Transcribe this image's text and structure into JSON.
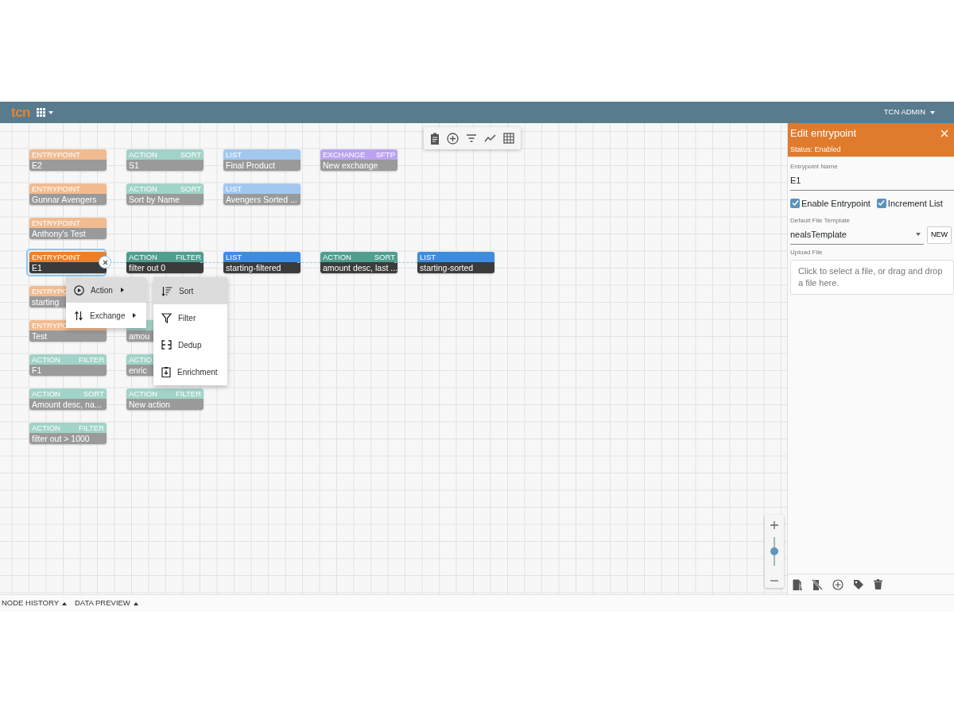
{
  "header": {
    "logo": "tcn",
    "user": "TCN ADMIN"
  },
  "canvas": {
    "rows": [
      [
        {
          "kind": "entrypoint",
          "label": "ENTRYPOINT",
          "name": "E2",
          "active": false,
          "selected": false
        },
        {
          "kind": "action",
          "label": "ACTION",
          "subtype": "SORT",
          "name": "S1",
          "active": false,
          "selected": false
        },
        {
          "kind": "list",
          "label": "LIST",
          "name": "Final Product",
          "active": false,
          "selected": false
        },
        {
          "kind": "exchange",
          "label": "EXCHANGE",
          "subtype": "SFTP",
          "name": "New exchange",
          "active": false,
          "selected": false
        }
      ],
      [
        {
          "kind": "entrypoint",
          "label": "ENTRYPOINT",
          "name": "Gunnar Avengers",
          "active": false,
          "selected": false
        },
        {
          "kind": "action",
          "label": "ACTION",
          "subtype": "SORT",
          "name": "Sort by Name",
          "active": false,
          "selected": false
        },
        {
          "kind": "list",
          "label": "LIST",
          "name": "Avengers Sorted ...",
          "active": false,
          "selected": false
        }
      ],
      [
        {
          "kind": "entrypoint",
          "label": "ENTRYPOINT",
          "name": "Anthony's Test",
          "active": false,
          "selected": false
        }
      ],
      [
        {
          "kind": "entrypoint",
          "label": "ENTRYPOINT",
          "name": "E1",
          "active": true,
          "selected": true
        },
        {
          "kind": "action",
          "label": "ACTION",
          "subtype": "FILTER",
          "name": "filter out 0",
          "active": true,
          "selected": false
        },
        {
          "kind": "list",
          "label": "LIST",
          "name": "starting-filtered",
          "active": true,
          "selected": false
        },
        {
          "kind": "action",
          "label": "ACTION",
          "subtype": "SORT",
          "name": "amount desc, last ...",
          "active": true,
          "selected": false
        },
        {
          "kind": "list",
          "label": "LIST",
          "name": "starting-sorted",
          "active": true,
          "selected": false
        }
      ],
      [
        {
          "kind": "entrypoint",
          "label": "ENTRYPO",
          "name": "starting",
          "active": false,
          "selected": false
        }
      ],
      [
        {
          "kind": "entrypoint",
          "label": "ENTRYPO",
          "name": "Test",
          "active": false,
          "selected": false
        },
        {
          "kind": "action",
          "name": "amou",
          "active": false,
          "selected": false
        }
      ],
      [
        {
          "kind": "action",
          "label": "ACTION",
          "subtype": "FILTER",
          "name": "F1",
          "active": false,
          "selected": false
        },
        {
          "kind": "action",
          "label": "ACTIO",
          "name": "enric",
          "active": false,
          "selected": false
        }
      ],
      [
        {
          "kind": "action",
          "label": "ACTION",
          "subtype": "SORT",
          "name": "Amount desc, na...",
          "active": false,
          "selected": false
        },
        {
          "kind": "action",
          "label": "ACTION",
          "subtype": "FILTER",
          "name": "New action",
          "active": false,
          "selected": false
        }
      ],
      [
        {
          "kind": "action",
          "label": "ACTION",
          "subtype": "FILTER",
          "name": "filter out > 1000",
          "active": false,
          "selected": false
        }
      ]
    ]
  },
  "context_menu": {
    "items": [
      {
        "kind": "action",
        "label": "Action",
        "selected": true
      },
      {
        "kind": "exchange",
        "label": "Exchange",
        "selected": false
      }
    ],
    "submenu": [
      {
        "kind": "sort",
        "label": "Sort",
        "selected": true
      },
      {
        "kind": "filter",
        "label": "Filter",
        "selected": false
      },
      {
        "kind": "dedup",
        "label": "Dedup",
        "selected": false
      },
      {
        "kind": "enrichment",
        "label": "Enrichment",
        "selected": false
      }
    ]
  },
  "zoom": {
    "level": 0.5
  },
  "panel": {
    "title": "Edit entrypoint",
    "status": "Status: Enabled",
    "name_label": "Entrypoint Name",
    "name_value": "E1",
    "checkboxes": [
      {
        "label": "Enable Entrypoint",
        "checked": true
      },
      {
        "label": "Increment List",
        "checked": true
      }
    ],
    "template_label": "Default File Template",
    "template_value": "nealsTemplate",
    "new_button": "NEW",
    "upload_label": "Upload File",
    "upload_hint": "Click to select a file, or drag and drop a file here."
  },
  "bottom_tabs": [
    "NODE HISTORY",
    "DATA PREVIEW"
  ]
}
